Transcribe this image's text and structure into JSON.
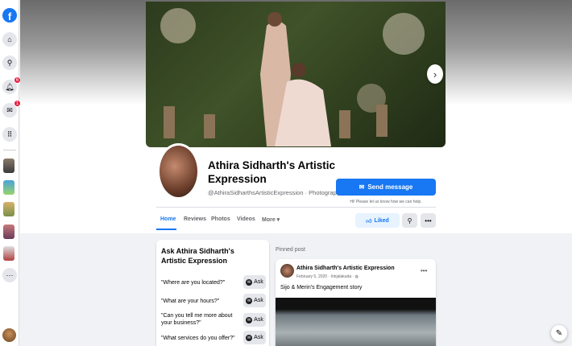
{
  "colors": {
    "brand": "#1877f2",
    "badge": "#e41e3f",
    "liked_bg": "#e7f3ff"
  },
  "rail": {
    "icons": [
      "facebook-logo",
      "home-icon",
      "search-icon",
      "bell-icon",
      "messenger-icon",
      "grid-menu-icon"
    ],
    "notifications_count": "6",
    "messages_count": "1",
    "more_label": "···"
  },
  "page": {
    "name": "Athira Sidharth's Artistic Expression",
    "subtitle": "@AthiraSidharthsArtisticExpression · Photographer",
    "send_message_label": "Send message",
    "reply_note": "Hi! Please let us know how we can help."
  },
  "tabs": [
    {
      "label": "Home",
      "active": true
    },
    {
      "label": "Reviews"
    },
    {
      "label": "Photos"
    },
    {
      "label": "Videos"
    },
    {
      "label": "More ▾"
    }
  ],
  "actions": {
    "liked_label": "Liked",
    "search_icon": "search-icon",
    "more_icon": "more-icon"
  },
  "ask_card": {
    "title": "Ask Athira Sidharth's Artistic Expression",
    "button_label": "Ask",
    "questions": [
      "\"Where are you located?\"",
      "\"What are your hours?\"",
      "\"Can you tell me more about your business?\"",
      "\"What services do you offer?\""
    ]
  },
  "pinned": {
    "label": "Pinned post",
    "author": "Athira Sidharth's Artistic Expression",
    "meta": "February 5, 2020 · Irinjalakuda ·",
    "text": "Sijo & Merin's Engagement story"
  }
}
